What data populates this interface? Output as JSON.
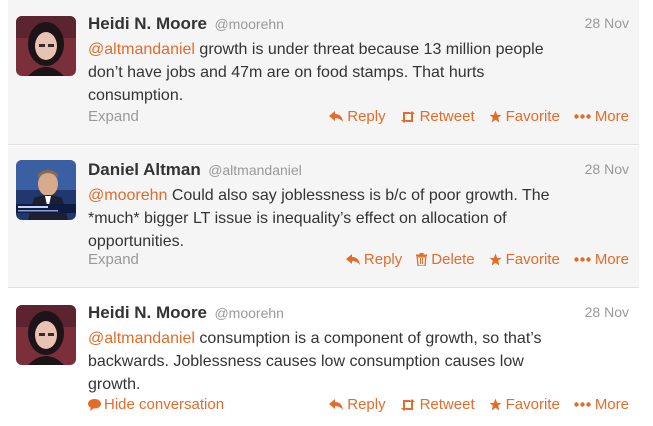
{
  "colors": {
    "accent": "#e36c2b",
    "muted": "#999999",
    "text": "#333333",
    "selected_bg": "#f5f5f5"
  },
  "tweets": [
    {
      "name": "Heidi N. Moore",
      "handle": "@moorehn",
      "date": "28 Nov",
      "mention": "@altmandaniel",
      "body": " growth is under threat because 13 million people\ndon’t have jobs and 47m are on food stamps. That hurts\nconsumption.",
      "footer_link": "Expand",
      "actions": [
        "Reply",
        "Retweet",
        "Favorite",
        "More"
      ]
    },
    {
      "name": "Daniel Altman",
      "handle": "@altmandaniel",
      "date": "28 Nov",
      "mention": "@moorehn",
      "body": " Could also say joblessness is b/c of poor growth. The\n*much* bigger LT issue is inequality’s effect on allocation of\nopportunities.",
      "footer_link": "Expand",
      "actions": [
        "Reply",
        "Delete",
        "Favorite",
        "More"
      ]
    },
    {
      "name": "Heidi N. Moore",
      "handle": "@moorehn",
      "date": "28 Nov",
      "mention": "@altmandaniel",
      "body": " consumption is a component of growth, so that’s\nbackwards. Joblessness causes low consumption causes low\ngrowth.",
      "footer_link": "Hide conversation",
      "actions": [
        "Reply",
        "Retweet",
        "Favorite",
        "More"
      ]
    }
  ]
}
